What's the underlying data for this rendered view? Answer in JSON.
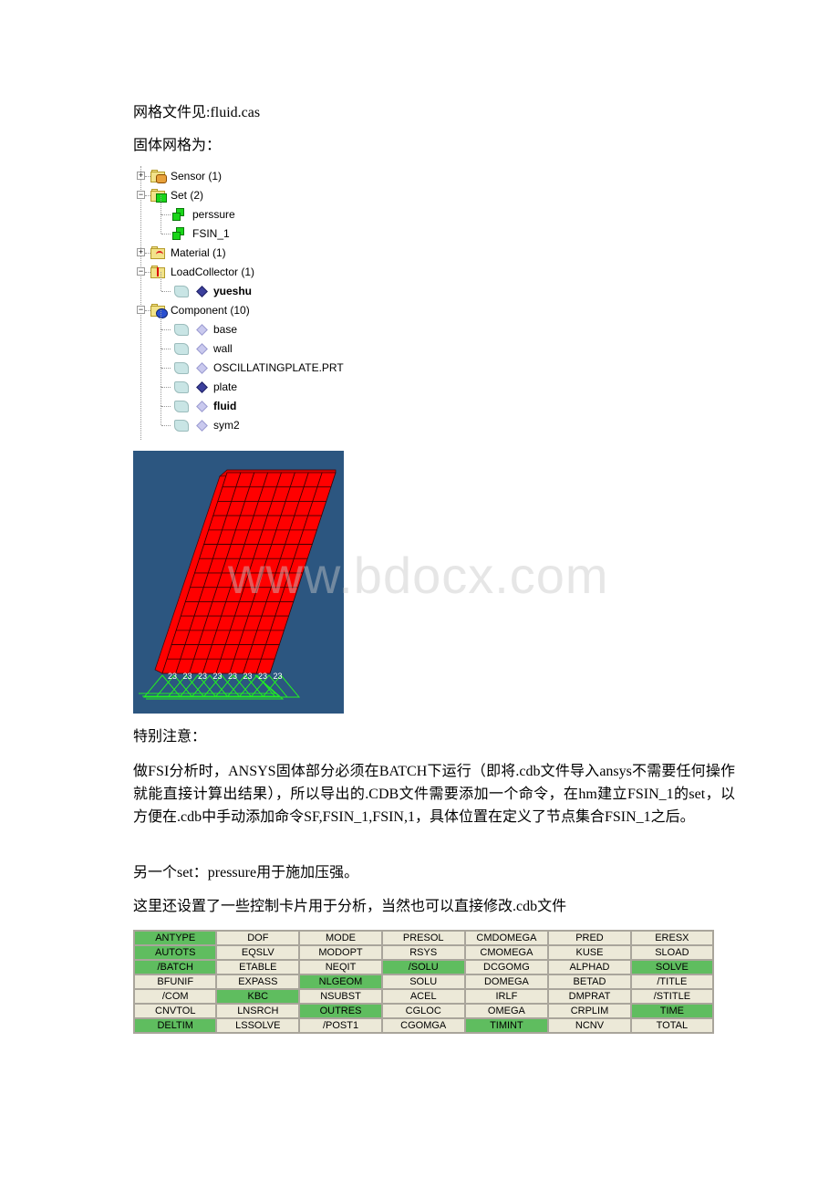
{
  "doc": {
    "line1": "网格文件见:fluid.cas",
    "line2": "固体网格为：",
    "note_heading": "特别注意：",
    "note_body": "做FSI分析时，ANSYS固体部分必须在BATCH下运行（即将.cdb文件导入ansys不需要任何操作就能直接计算出结果），所以导出的.CDB文件需要添加一个命令，在hm建立FSIN_1的set，以方便在.cdb中手动添加命令SF,FSIN_1,FSIN,1，具体位置在定义了节点集合FSIN_1之后。",
    "pressure_note": "另一个set：pressure用于施加压强。",
    "control_note": "这里还设置了一些控制卡片用于分析，当然也可以直接修改.cdb文件",
    "watermark": "www.bdocx.com"
  },
  "tree": {
    "nodes": [
      {
        "label": "Sensor (1)",
        "icon": "sensor-folder-icon",
        "level": 0,
        "expander": "+"
      },
      {
        "label": "Set (2)",
        "icon": "set-folder-icon",
        "level": 0,
        "expander": "-"
      },
      {
        "label": "perssure",
        "icon": "set-icon",
        "level": 1
      },
      {
        "label": "FSIN_1",
        "icon": "set-icon",
        "level": 1
      },
      {
        "label": "Material (1)",
        "icon": "material-folder-icon",
        "level": 0,
        "expander": "+"
      },
      {
        "label": "LoadCollector (1)",
        "icon": "loadcollector-folder-icon",
        "level": 0,
        "expander": "-"
      },
      {
        "label": "yueshu",
        "icon": "loadcollector-icon",
        "level": 1,
        "bold": true,
        "active": true
      },
      {
        "label": "Component (10)",
        "icon": "component-folder-icon",
        "level": 0,
        "expander": "-"
      },
      {
        "label": "base",
        "icon": "component-icon",
        "level": 1
      },
      {
        "label": "wall",
        "icon": "component-icon",
        "level": 1
      },
      {
        "label": "OSCILLATINGPLATE.PRT",
        "icon": "component-icon",
        "level": 1
      },
      {
        "label": "plate",
        "icon": "component-icon",
        "level": 1,
        "active": true
      },
      {
        "label": "fluid",
        "icon": "component-icon",
        "level": 1,
        "bold": true
      },
      {
        "label": "sym2",
        "icon": "component-icon",
        "level": 1
      }
    ]
  },
  "mesh": {
    "colors": {
      "background": "#2c5680",
      "elements": "#ff0000",
      "constraints": "#22ee22",
      "labels": "#ffffff"
    },
    "constraint_label": "23",
    "constraint_count": 8
  },
  "commands": {
    "active_color": "#5fbd5f",
    "inactive_color": "#ece9d8",
    "rows": [
      [
        {
          "t": "ANTYPE",
          "on": true
        },
        {
          "t": "DOF",
          "on": false
        },
        {
          "t": "MODE",
          "on": false
        },
        {
          "t": "PRESOL",
          "on": false
        },
        {
          "t": "CMDOMEGA",
          "on": false
        },
        {
          "t": "PRED",
          "on": false
        },
        {
          "t": "ERESX",
          "on": false
        }
      ],
      [
        {
          "t": "AUTOTS",
          "on": true
        },
        {
          "t": "EQSLV",
          "on": false
        },
        {
          "t": "MODOPT",
          "on": false
        },
        {
          "t": "RSYS",
          "on": false
        },
        {
          "t": "CMOMEGA",
          "on": false
        },
        {
          "t": "KUSE",
          "on": false
        },
        {
          "t": "SLOAD",
          "on": false
        }
      ],
      [
        {
          "t": "/BATCH",
          "on": true
        },
        {
          "t": "ETABLE",
          "on": false
        },
        {
          "t": "NEQIT",
          "on": false
        },
        {
          "t": "/SOLU",
          "on": true
        },
        {
          "t": "DCGOMG",
          "on": false
        },
        {
          "t": "ALPHAD",
          "on": false
        },
        {
          "t": "SOLVE",
          "on": true
        }
      ],
      [
        {
          "t": "BFUNIF",
          "on": false
        },
        {
          "t": "EXPASS",
          "on": false
        },
        {
          "t": "NLGEOM",
          "on": true
        },
        {
          "t": "SOLU",
          "on": false
        },
        {
          "t": "DOMEGA",
          "on": false
        },
        {
          "t": "BETAD",
          "on": false
        },
        {
          "t": "/TITLE",
          "on": false
        }
      ],
      [
        {
          "t": "/COM",
          "on": false
        },
        {
          "t": "KBC",
          "on": true
        },
        {
          "t": "NSUBST",
          "on": false
        },
        {
          "t": "ACEL",
          "on": false
        },
        {
          "t": "IRLF",
          "on": false
        },
        {
          "t": "DMPRAT",
          "on": false
        },
        {
          "t": "/STITLE",
          "on": false
        }
      ],
      [
        {
          "t": "CNVTOL",
          "on": false
        },
        {
          "t": "LNSRCH",
          "on": false
        },
        {
          "t": "OUTRES",
          "on": true
        },
        {
          "t": "CGLOC",
          "on": false
        },
        {
          "t": "OMEGA",
          "on": false
        },
        {
          "t": "CRPLIM",
          "on": false
        },
        {
          "t": "TIME",
          "on": true
        }
      ],
      [
        {
          "t": "DELTIM",
          "on": true
        },
        {
          "t": "LSSOLVE",
          "on": false
        },
        {
          "t": "/POST1",
          "on": false
        },
        {
          "t": "CGOMGA",
          "on": false
        },
        {
          "t": "TIMINT",
          "on": true
        },
        {
          "t": "NCNV",
          "on": false
        },
        {
          "t": "TOTAL",
          "on": false
        }
      ]
    ]
  }
}
